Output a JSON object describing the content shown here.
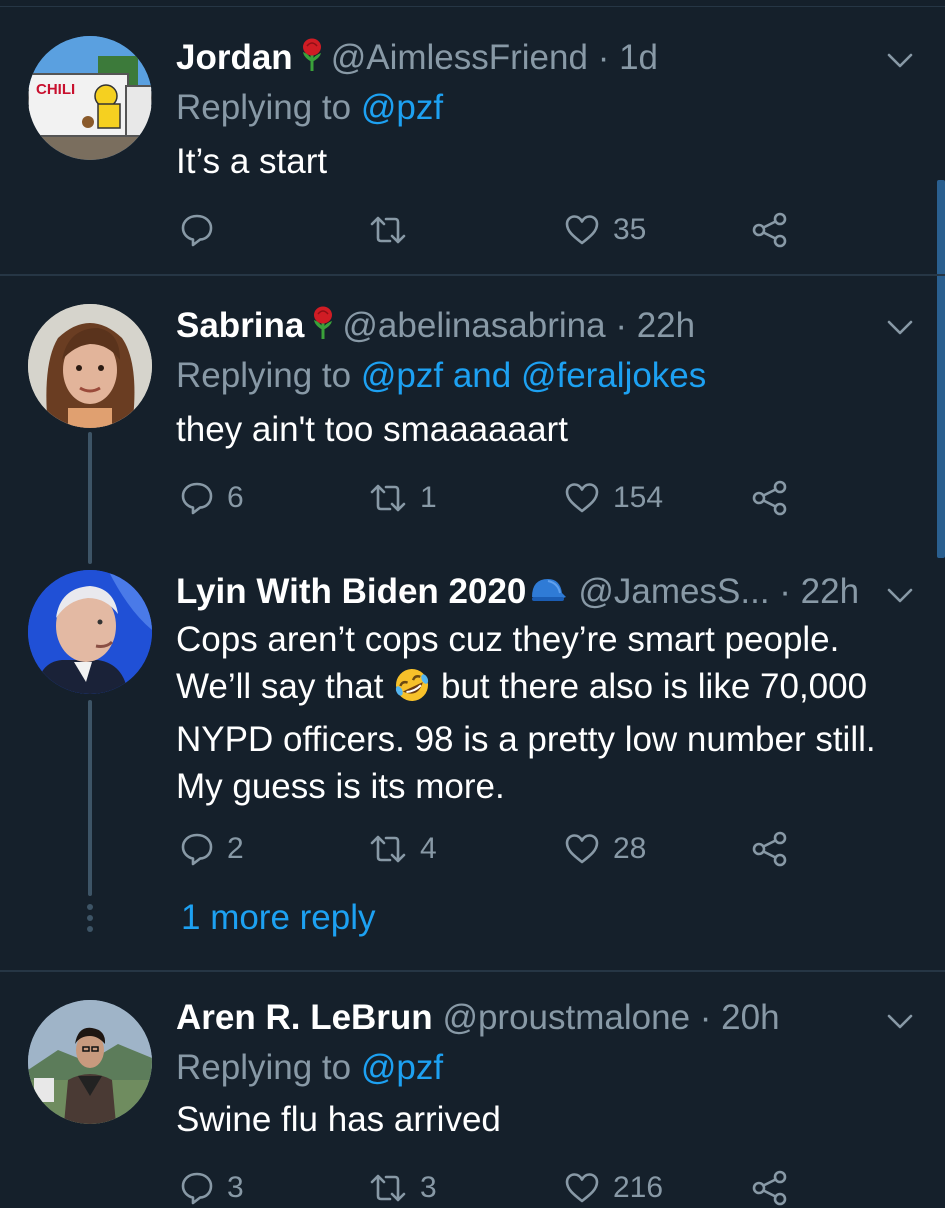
{
  "tweets": [
    {
      "name": "Jordan",
      "badge_icon": "rose-emoji",
      "handle": "@AimlessFriend",
      "dot": "·",
      "time": "1d",
      "replying_prefix": "Replying to",
      "replying_links": [
        "@pzf"
      ],
      "text": "It’s a start",
      "avatar_text": "CHILI",
      "replies": "",
      "retweets": "",
      "likes": "35"
    },
    {
      "name": "Sabrina",
      "badge_icon": "rose-emoji",
      "handle": "@abelinasabrina",
      "dot": "·",
      "time": "22h",
      "replying_prefix": "Replying to",
      "replying_links": [
        "@pzf",
        "@feraljokes"
      ],
      "replying_joiner": "and",
      "text": "they ain't too smaaaaaart",
      "replies": "6",
      "retweets": "1",
      "likes": "154"
    },
    {
      "name": "Lyin With Biden 2020",
      "badge_icon": "blue-cap-emoji",
      "handle": "@JamesS...",
      "dot": "·",
      "time": "22h",
      "text_lines": [
        "Cops aren’t cops cuz they’re smart people.",
        "We’ll say that",
        "but there also is like 70,000",
        "NYPD officers. 98 is a pretty low number still.",
        "My guess is its more."
      ],
      "inline_emoji": "rolling-on-floor-laughing-emoji",
      "replies": "2",
      "retweets": "4",
      "likes": "28"
    },
    {
      "name": "Aren R. LeBrun",
      "handle": "@proustmalone",
      "dot": "·",
      "time": "20h",
      "replying_prefix": "Replying to",
      "replying_links": [
        "@pzf"
      ],
      "text": "Swine flu has arrived",
      "replies": "3",
      "retweets": "3",
      "likes": "216"
    }
  ],
  "thread": {
    "more_replies": "1 more reply"
  },
  "colors": {
    "background": "#15202b",
    "secondary_text": "#8899a6",
    "link": "#1da1f2",
    "separator": "#263645"
  }
}
